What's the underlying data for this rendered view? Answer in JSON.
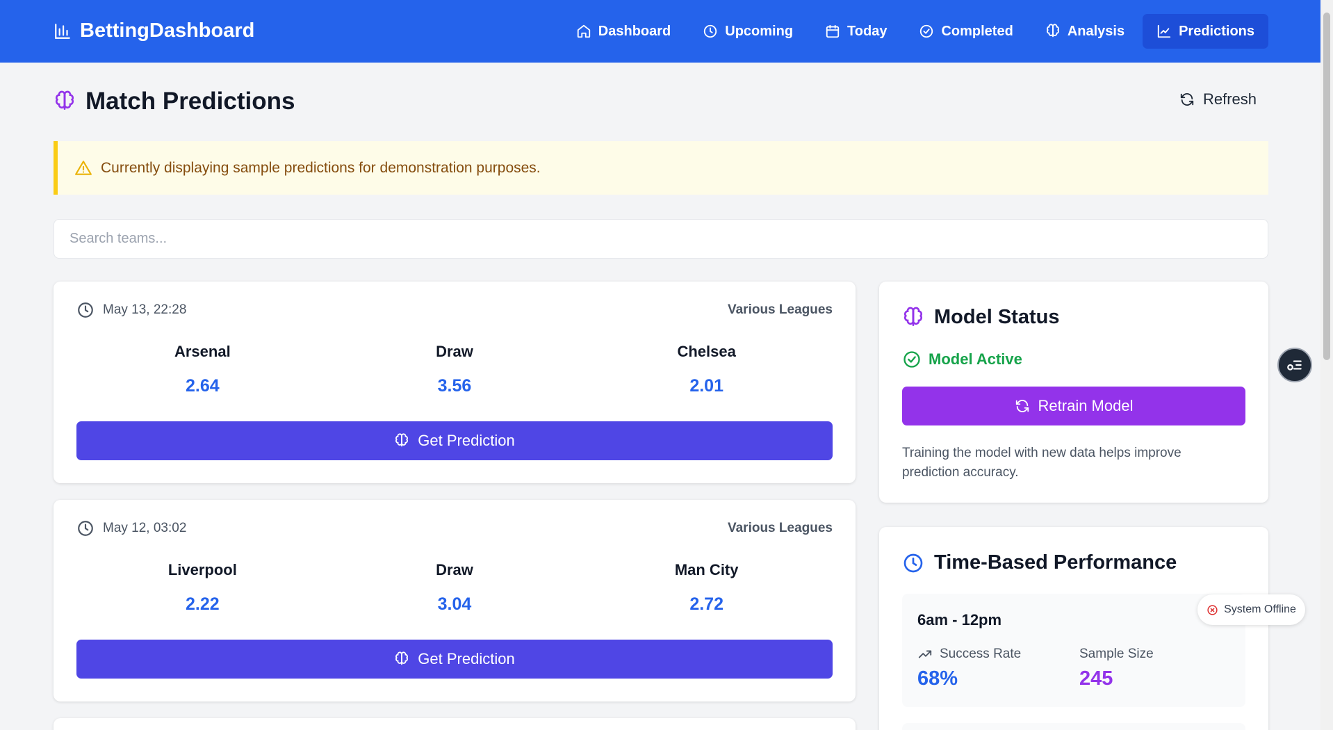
{
  "brand": {
    "name": "BettingDashboard",
    "icon": "bar-chart-icon"
  },
  "nav": {
    "items": [
      {
        "label": "Dashboard",
        "icon": "home-icon"
      },
      {
        "label": "Upcoming",
        "icon": "clock-icon"
      },
      {
        "label": "Today",
        "icon": "calendar-icon"
      },
      {
        "label": "Completed",
        "icon": "check-circle-icon"
      },
      {
        "label": "Analysis",
        "icon": "brain-icon"
      },
      {
        "label": "Predictions",
        "icon": "line-chart-icon",
        "active": true
      }
    ]
  },
  "page": {
    "title": "Match Predictions",
    "refresh_label": "Refresh"
  },
  "alert": {
    "text": "Currently displaying sample predictions for demonstration purposes."
  },
  "search": {
    "placeholder": "Search teams..."
  },
  "matches": [
    {
      "time": "May 13, 22:28",
      "league": "Various Leagues",
      "home": "Arsenal",
      "draw_label": "Draw",
      "away": "Chelsea",
      "home_odds": "2.64",
      "draw_odds": "3.56",
      "away_odds": "2.01",
      "button": "Get Prediction"
    },
    {
      "time": "May 12, 03:02",
      "league": "Various Leagues",
      "home": "Liverpool",
      "draw_label": "Draw",
      "away": "Man City",
      "home_odds": "2.22",
      "draw_odds": "3.04",
      "away_odds": "2.72",
      "button": "Get Prediction"
    }
  ],
  "model_status": {
    "title": "Model Status",
    "status": "Model Active",
    "retrain_label": "Retrain Model",
    "description": "Training the model with new data helps improve prediction accuracy."
  },
  "time_performance": {
    "title": "Time-Based Performance",
    "blocks": [
      {
        "period": "6am - 12pm",
        "success_label": "Success Rate",
        "success_value": "68%",
        "sample_label": "Sample Size",
        "sample_value": "245"
      }
    ]
  },
  "system_status": {
    "label": "System Offline"
  },
  "colors": {
    "primary": "#2563eb",
    "indigo": "#4f46e5",
    "purple": "#9333ea",
    "success": "#16a34a",
    "warning_bg": "#fefce8",
    "warning_border": "#facc15"
  }
}
